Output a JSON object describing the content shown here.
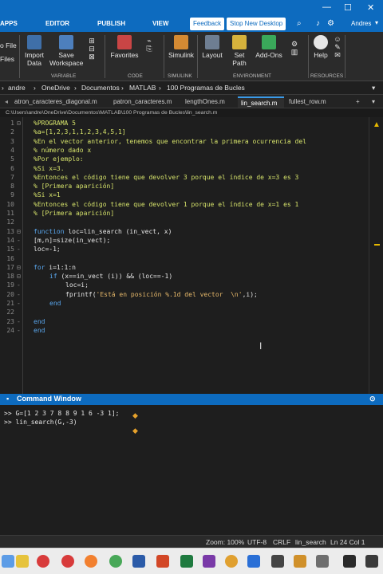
{
  "ribbon_tabs": {
    "apps": "APPS",
    "editor": "EDITOR",
    "publish": "PUBLISH",
    "view": "VIEW",
    "feedback": "Feedback",
    "stop_new_desktop": "Stop New Desktop",
    "user": "Andres"
  },
  "ribbon": {
    "open_file": "o File",
    "files": "Files",
    "import_data": [
      "Import",
      "Data"
    ],
    "save_workspace": [
      "Save",
      "Workspace"
    ],
    "favorites": "Favorites",
    "simulink": "Simulink",
    "layout": "Layout",
    "set_path": "Set Path",
    "add_ons": "Add-Ons",
    "help": "Help",
    "groups": {
      "variable": "VARIABLE",
      "code": "CODE",
      "simulink": "SIMULINK",
      "environment": "ENVIRONMENT",
      "resources": "RESOURCES"
    }
  },
  "address": {
    "items": [
      "andre",
      "OneDrive",
      "Documentos",
      "MATLAB",
      "100 Programas de Bucles"
    ]
  },
  "file_tabs": [
    "atron_caracteres_diagonal.m",
    "patron_caracteres.m",
    "lengthOnes.m",
    "lin_search.m",
    "fullest_row.m"
  ],
  "active_tab_index": 3,
  "path": "C:\\Users\\andre\\OneDrive\\Documentos\\MATLAB\\100 Programas de Bucles\\lin_search.m",
  "code_lines": [
    {
      "n": "1",
      "text": "%PROGRAMA 5",
      "cls": "cmt",
      "indent": 0
    },
    {
      "n": "2",
      "text": "%a=[1,2,3,1,1,2,3,4,5,1]",
      "cls": "cmt",
      "indent": 0
    },
    {
      "n": "3",
      "text": "%En el vector anterior, tenemos que encontrar la primera ocurrencia del",
      "cls": "cmt",
      "indent": 0
    },
    {
      "n": "4",
      "text": "% número dado x",
      "cls": "cmt",
      "indent": 0
    },
    {
      "n": "5",
      "text": "%Por ejemplo:",
      "cls": "cmt",
      "indent": 0
    },
    {
      "n": "6",
      "text": "%Si x=3.",
      "cls": "cmt",
      "indent": 0
    },
    {
      "n": "7",
      "text": "%Entonces el código tiene que devolver 3 porque el índice de x=3 es 3",
      "cls": "cmt",
      "indent": 0
    },
    {
      "n": "8",
      "text": "% [Primera aparición]",
      "cls": "cmt",
      "indent": 0
    },
    {
      "n": "9",
      "text": "%Si x=1",
      "cls": "cmt",
      "indent": 0
    },
    {
      "n": "10",
      "text": "%Entonces el código tiene que devolver 1 porque el índice de x=1 es 1",
      "cls": "cmt",
      "indent": 0
    },
    {
      "n": "11",
      "text": "% [Primera aparición]",
      "cls": "cmt",
      "indent": 0
    },
    {
      "n": "12",
      "text": "",
      "cls": "txt",
      "indent": 0
    },
    {
      "n": "13",
      "text": "function loc=lin_search (in_vect, x)",
      "cls": "fn",
      "indent": 0
    },
    {
      "n": "14",
      "text": "[m,n]=size(in_vect);",
      "cls": "txt",
      "indent": 0
    },
    {
      "n": "15",
      "text": "loc=-1;",
      "cls": "txt",
      "indent": 0
    },
    {
      "n": "16",
      "text": "",
      "cls": "txt",
      "indent": 0
    },
    {
      "n": "17",
      "text": "for i=1:1:n",
      "cls": "for",
      "indent": 0
    },
    {
      "n": "18",
      "text": "if (x==in_vect (i)) && (loc==-1)",
      "cls": "if",
      "indent": 1
    },
    {
      "n": "19",
      "text": "loc=i;",
      "cls": "txt",
      "indent": 2
    },
    {
      "n": "20",
      "text": "fprintf('Está en posición %.1d del vector  \\n',i);",
      "cls": "printf",
      "indent": 2
    },
    {
      "n": "21",
      "text": "end",
      "cls": "kw",
      "indent": 1
    },
    {
      "n": "22",
      "text": "",
      "cls": "txt",
      "indent": 0
    },
    {
      "n": "23",
      "text": "end",
      "cls": "kw",
      "indent": 0
    },
    {
      "n": "24",
      "text": "end",
      "cls": "kw",
      "indent": 0
    }
  ],
  "command_window": {
    "title": "Command Window",
    "lines": [
      ">> G=[1 2 3 7 8 8 9 1 6 -3 1];",
      ">> lin_search(G,-3)"
    ]
  },
  "status": {
    "zoom": "Zoom: 100%",
    "encoding": "UTF-8",
    "eol": "CRLF",
    "file": "lin_search",
    "position": "Ln 24 Col 1"
  },
  "colors": {
    "accent": "#0d6bbf",
    "comment": "#d6e36b",
    "keyword": "#5aa8f0",
    "string": "#e6b86a"
  }
}
